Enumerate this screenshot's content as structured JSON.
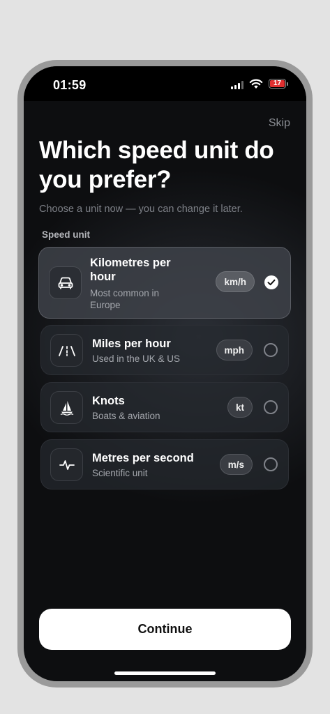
{
  "status_bar": {
    "time": "01:59",
    "battery_level": "17"
  },
  "header": {
    "skip_label": "Skip",
    "title": "Which speed unit do you prefer?",
    "subtitle": "Choose a unit now — you can change it later."
  },
  "section_label": "Speed unit",
  "options": [
    {
      "title": "Kilometres per hour",
      "desc": "Most common in Europe",
      "unit": "km/h",
      "icon": "car-icon",
      "selected": true
    },
    {
      "title": "Miles per hour",
      "desc": "Used in the UK & US",
      "unit": "mph",
      "icon": "road-icon",
      "selected": false
    },
    {
      "title": "Knots",
      "desc": "Boats & aviation",
      "unit": "kt",
      "icon": "sailboat-icon",
      "selected": false
    },
    {
      "title": "Metres per second",
      "desc": "Scientific unit",
      "unit": "m/s",
      "icon": "pulse-icon",
      "selected": false
    }
  ],
  "continue_label": "Continue",
  "colors": {
    "background": "#0d0e10",
    "selected_card": "#40434a",
    "button": "#ffffff",
    "battery": "#e03030"
  }
}
